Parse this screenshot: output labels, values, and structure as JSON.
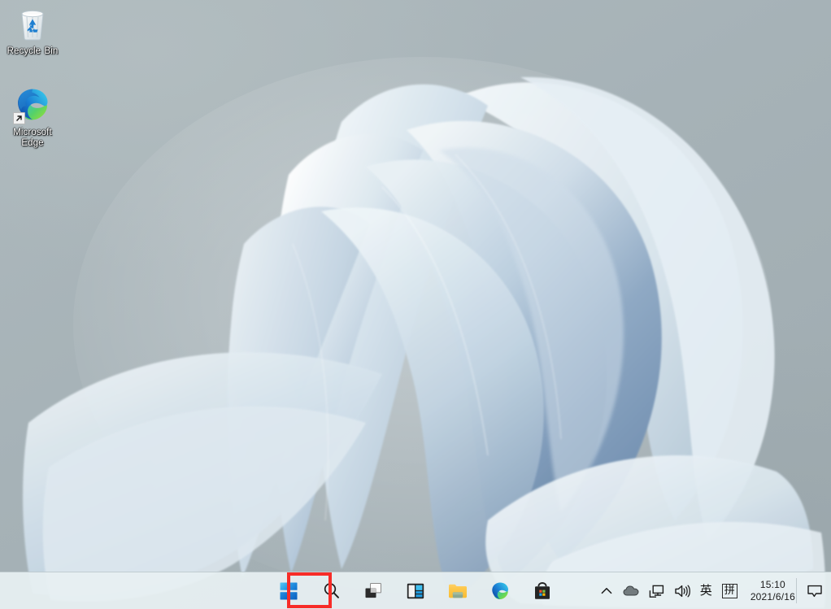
{
  "desktop": {
    "icons": [
      {
        "name": "recycle-bin",
        "label": "Recycle Bin",
        "icon": "recycle-bin-icon"
      },
      {
        "name": "microsoft-edge",
        "label_line1": "Microsoft",
        "label_line2": "Edge",
        "label": "Microsoft Edge",
        "icon": "edge-icon",
        "has_shortcut_arrow": true
      }
    ],
    "wallpaper_name": "windows-11-bloom-wallpaper",
    "background_color": "#a9b5b9"
  },
  "taskbar": {
    "background_color": "#e7f0f2",
    "buttons": [
      {
        "name": "start-button",
        "label": "Start",
        "icon": "windows-logo-icon",
        "highlighted": true
      },
      {
        "name": "search-button",
        "label": "Search",
        "icon": "search-icon"
      },
      {
        "name": "task-view-button",
        "label": "Task View",
        "icon": "task-view-icon"
      },
      {
        "name": "widgets-button",
        "label": "Widgets",
        "icon": "widgets-icon"
      },
      {
        "name": "file-explorer-button",
        "label": "File Explorer",
        "icon": "folder-icon"
      },
      {
        "name": "edge-button",
        "label": "Microsoft Edge",
        "icon": "edge-icon"
      },
      {
        "name": "store-button",
        "label": "Microsoft Store",
        "icon": "store-bag-icon"
      }
    ],
    "tray": {
      "items": [
        {
          "name": "show-hidden-icons",
          "label": "Show hidden icons",
          "icon": "chevron-up-icon"
        },
        {
          "name": "onedrive",
          "label": "OneDrive",
          "icon": "cloud-icon"
        },
        {
          "name": "network",
          "label": "Network",
          "icon": "network-monitor-icon"
        },
        {
          "name": "volume",
          "label": "Volume",
          "icon": "speaker-icon"
        },
        {
          "name": "ime-mode",
          "label": "英",
          "icon": "ime-english-icon"
        },
        {
          "name": "ime-pinyin",
          "label": "拼",
          "icon": "ime-pinyin-icon"
        }
      ],
      "clock": {
        "time": "15:10",
        "date": "2021/6/16"
      },
      "notifications": {
        "name": "notification-center",
        "label": "Notifications",
        "icon": "chat-bubble-icon"
      }
    },
    "highlight_color": "#f72c28"
  }
}
